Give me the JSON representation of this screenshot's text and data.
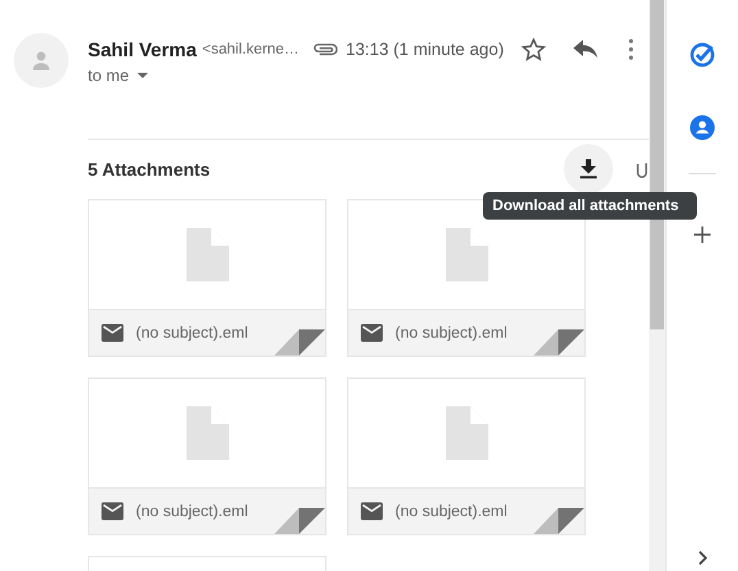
{
  "message": {
    "sender_name": "Sahil Verma",
    "sender_email": "<sahil.kerne…",
    "time": "13:13 (1 minute ago)",
    "starred": false,
    "recipient": "to me"
  },
  "attachments": {
    "title": "5 Attachments",
    "tooltip": "Download all attachments",
    "items": [
      {
        "kind": "file",
        "name": "(no subject).eml"
      },
      {
        "kind": "file",
        "name": "(no subject).eml"
      },
      {
        "kind": "file",
        "name": "(no subject).eml"
      },
      {
        "kind": "file",
        "name": "(no subject).eml"
      },
      {
        "kind": "partial"
      }
    ]
  }
}
